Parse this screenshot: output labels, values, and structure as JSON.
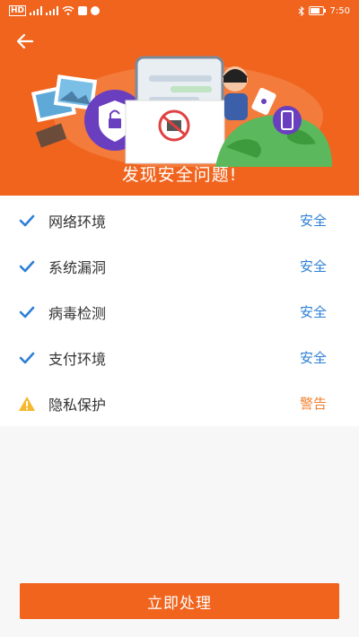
{
  "status_bar": {
    "left_indicators": "HD",
    "right_time": "7:50",
    "colors": {
      "text": "#ffffff"
    },
    "icons": [
      "signal-icon",
      "wifi-icon",
      "notification-icon",
      "bluetooth-icon",
      "battery-icon"
    ]
  },
  "header": {
    "background_color": "#f0641e",
    "banner_title": "发现安全问题!",
    "back_icon": "arrow-left-icon"
  },
  "checks": [
    {
      "label": "网络环境",
      "status": "安全",
      "state": "safe",
      "icon": "check-icon"
    },
    {
      "label": "系统漏洞",
      "status": "安全",
      "state": "safe",
      "icon": "check-icon"
    },
    {
      "label": "病毒检测",
      "status": "安全",
      "state": "safe",
      "icon": "check-icon"
    },
    {
      "label": "支付环境",
      "status": "安全",
      "state": "safe",
      "icon": "check-icon"
    },
    {
      "label": "隐私保护",
      "status": "警告",
      "state": "warning",
      "icon": "warning-icon"
    }
  ],
  "colors": {
    "accent": "#f0641e",
    "safe": "#2d7fd6",
    "warning": "#f08030"
  },
  "action": {
    "label": "立即处理"
  }
}
